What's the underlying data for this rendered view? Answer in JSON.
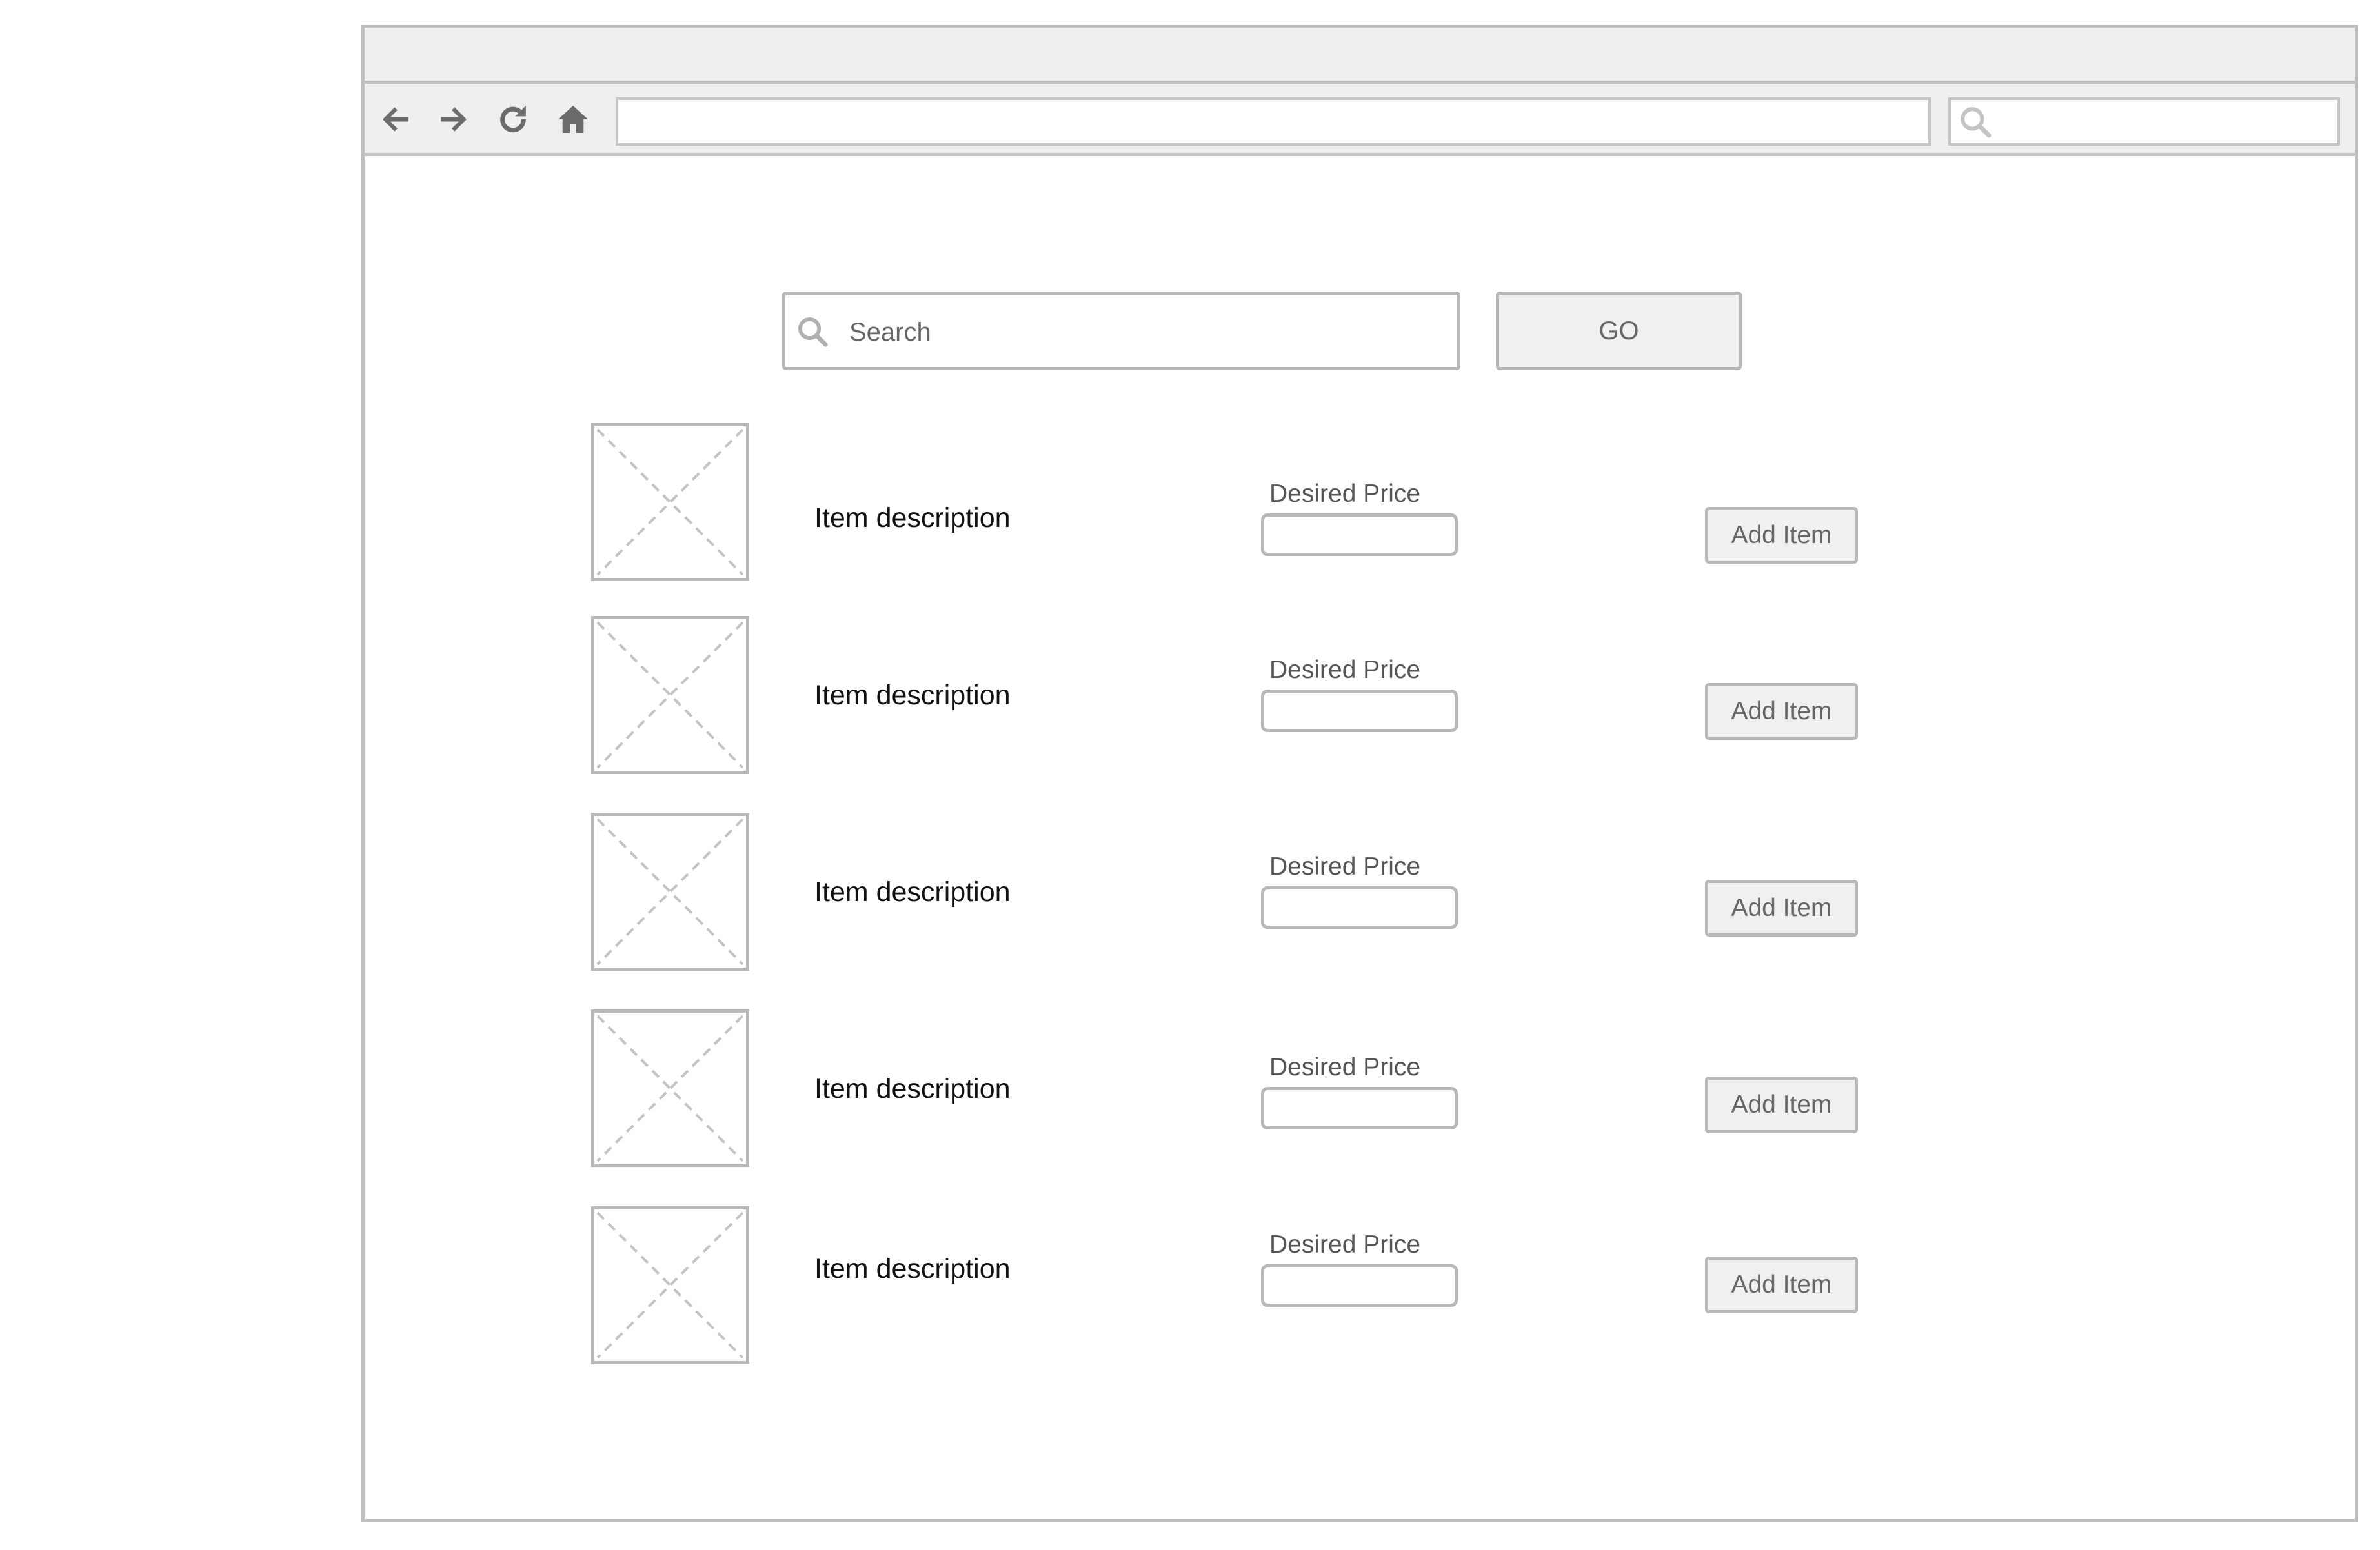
{
  "browser": {
    "address_value": "",
    "search_value": ""
  },
  "search": {
    "placeholder": "Search",
    "go_label": "GO"
  },
  "items": [
    {
      "description": "Item description",
      "price_label": "Desired Price",
      "price_value": "",
      "button_label": "Add Item"
    },
    {
      "description": "Item description",
      "price_label": "Desired Price",
      "price_value": "",
      "button_label": "Add Item"
    },
    {
      "description": "Item description",
      "price_label": "Desired Price",
      "price_value": "",
      "button_label": "Add Item"
    },
    {
      "description": "Item description",
      "price_label": "Desired Price",
      "price_value": "",
      "button_label": "Add Item"
    },
    {
      "description": "Item description",
      "price_label": "Desired Price",
      "price_value": "",
      "button_label": "Add Item"
    }
  ],
  "colors": {
    "chrome": "#efefef",
    "border": "#c0c0c0",
    "icon": "#6b6b6b",
    "button_fill": "#f0f0f0"
  }
}
